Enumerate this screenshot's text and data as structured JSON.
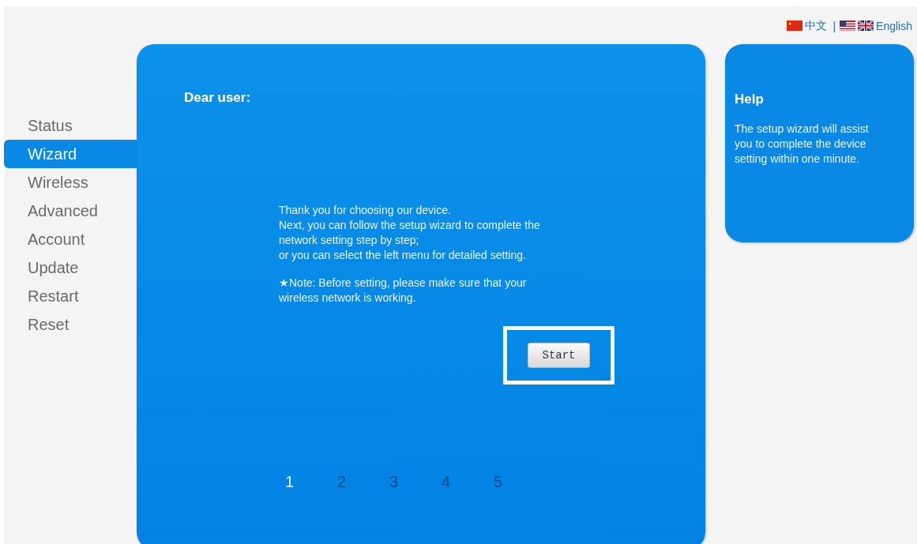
{
  "languages": [
    {
      "kind": "china",
      "label": "中文"
    },
    {
      "kind": "separator",
      "label": "|"
    },
    {
      "kind": "usa"
    },
    {
      "kind": "uk",
      "label": "English"
    }
  ],
  "sidebar": {
    "items": [
      {
        "label": "Status",
        "selected": false
      },
      {
        "label": "Wizard",
        "selected": true
      },
      {
        "label": "Wireless",
        "selected": false
      },
      {
        "label": "Advanced",
        "selected": false
      },
      {
        "label": "Account",
        "selected": false
      },
      {
        "label": "Update",
        "selected": false
      },
      {
        "label": "Restart",
        "selected": false
      },
      {
        "label": "Reset",
        "selected": false
      }
    ]
  },
  "main": {
    "heading": "Dear user:",
    "paragraphs": [
      "Thank you for choosing our device.\nNext, you can follow the setup wizard to complete the\nnetwork setting step by step;\nor you can select the left menu for detailed setting.",
      "★Note: Before setting, please make sure that your\nwireless network is working."
    ],
    "start_button": {
      "label": "Start",
      "highlighted": true
    },
    "steps": [
      {
        "label": "1",
        "selected": true
      },
      {
        "label": "2",
        "selected": false
      },
      {
        "label": "3",
        "selected": false
      },
      {
        "label": "4",
        "selected": false
      },
      {
        "label": "5",
        "selected": false
      }
    ]
  },
  "help": {
    "title": "Help",
    "text": "The setup wizard will assist you to complete the device setting within one minute."
  }
}
